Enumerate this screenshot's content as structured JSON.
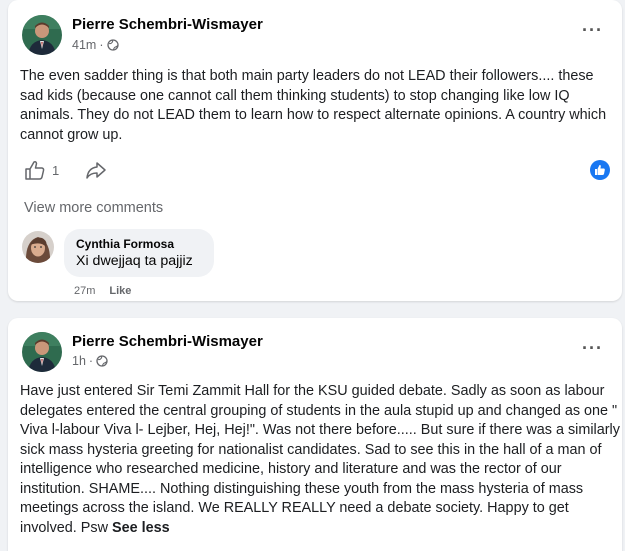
{
  "posts": [
    {
      "author": "Pierre Schembri-Wismayer",
      "time": "41m",
      "text": "The even sadder thing is that both main party leaders do not LEAD their followers.... these sad kids (because one cannot call them thinking students) to stop changing like low IQ animals. They do not LEAD them to learn how to respect alternate opinions. A country which cannot grow up.",
      "like_count": "1",
      "view_more": "View more comments",
      "comment": {
        "author": "Cynthia Formosa",
        "text": "Xi dwejjaq ta pajjiz",
        "time": "27m",
        "like": "Like"
      }
    },
    {
      "author": "Pierre Schembri-Wismayer",
      "time": "1h",
      "text": "Have just entered Sir Temi Zammit Hall for the KSU guided debate. Sadly as soon as labour delegates entered the central grouping of students in the aula stupid up and changed as one \" Viva l-labour Viva l- Lejber, Hej, Hej!\". Was not there before..... But sure if there was a similarly sick mass hysteria greeting for nationalist candidates. Sad to see this in the hall of a man of intelligence who researched medicine, history and literature and was the rector of our institution. SHAME.... Nothing distinguishing these youth from the mass hysteria of mass meetings across the island. We REALLY REALLY need a debate society. Happy to get involved. Psw",
      "see_less": "See less"
    }
  ],
  "colors": {
    "accent": "#1877f2",
    "background": "#f0f2f5",
    "secondary_text": "#65676b"
  },
  "icons": [
    "more-icon",
    "globe-icon",
    "thumbs-up-icon",
    "share-icon",
    "like-reaction-icon"
  ]
}
